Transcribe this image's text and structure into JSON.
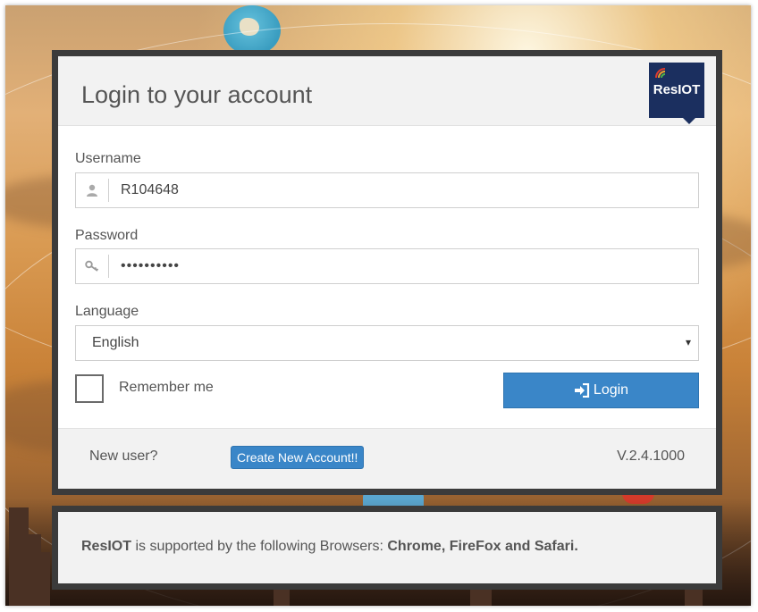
{
  "login": {
    "title": "Login to your account",
    "logo_text": "ResIOT",
    "username_label": "Username",
    "username_value": "R104648",
    "password_label": "Password",
    "password_value": "••••••••••",
    "language_label": "Language",
    "language_selected": "English",
    "remember_label": "Remember me",
    "remember_checked": false,
    "login_button": "Login",
    "new_user_label": "New user?",
    "create_account_button": "Create New Account!!",
    "version": "V.2.4.1000"
  },
  "browser_notice": {
    "brand": "ResIOT",
    "text": " is supported by the following Browsers: ",
    "browsers": "Chrome, FireFox and Safari."
  },
  "icons": {
    "username": "user-icon",
    "password": "key-icon",
    "login": "sign-in-icon",
    "select": "caret-down-icon"
  },
  "colors": {
    "primary_button": "#3a86c8",
    "logo_background": "#1b2f5f",
    "card_border": "#3b3b3b"
  }
}
